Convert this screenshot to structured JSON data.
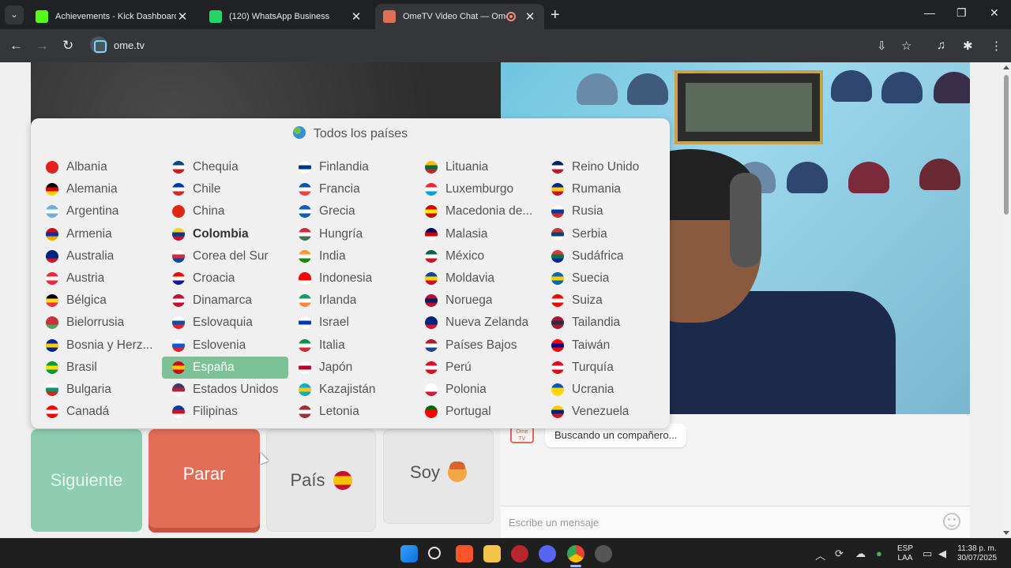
{
  "browser": {
    "tabs": [
      {
        "title": "Achievements - Kick Dashboard",
        "favicon": "kick-icon",
        "color": "#53fc18",
        "active": false
      },
      {
        "title": "(120) WhatsApp Business",
        "favicon": "whatsapp-icon",
        "color": "#25d366",
        "active": false
      },
      {
        "title": "OmeTV Video Chat — Omegle R",
        "favicon": "ometv-icon",
        "color": "#e36e58",
        "active": true
      }
    ],
    "url": "ome.tv"
  },
  "page": {
    "dropdown": {
      "header": "Todos los países",
      "columns": [
        [
          {
            "name": "Albania",
            "flag": [
              "#e41e20",
              "#e41e20",
              "#e41e20"
            ]
          },
          {
            "name": "Alemania",
            "flag": [
              "#000000",
              "#dd0000",
              "#ffce00"
            ]
          },
          {
            "name": "Argentina",
            "flag": [
              "#74acdf",
              "#ffffff",
              "#74acdf"
            ]
          },
          {
            "name": "Armenia",
            "flag": [
              "#d90012",
              "#0033a0",
              "#f2a800"
            ]
          },
          {
            "name": "Australia",
            "flag": [
              "#00247d",
              "#00247d",
              "#cf142b"
            ]
          },
          {
            "name": "Austria",
            "flag": [
              "#ed2939",
              "#ffffff",
              "#ed2939"
            ]
          },
          {
            "name": "Bélgica",
            "flag": [
              "#000000",
              "#fdda24",
              "#ef3340"
            ]
          },
          {
            "name": "Bielorrusia",
            "flag": [
              "#c8313e",
              "#c8313e",
              "#4aa657"
            ]
          },
          {
            "name": "Bosnia y Herz...",
            "flag": [
              "#002395",
              "#fecb00",
              "#002395"
            ]
          },
          {
            "name": "Brasil",
            "flag": [
              "#009c3b",
              "#ffdf00",
              "#009c3b"
            ]
          },
          {
            "name": "Bulgaria",
            "flag": [
              "#ffffff",
              "#00966e",
              "#d62612"
            ]
          },
          {
            "name": "Canadá",
            "flag": [
              "#ff0000",
              "#ffffff",
              "#ff0000"
            ]
          }
        ],
        [
          {
            "name": "Chequia",
            "flag": [
              "#11457e",
              "#ffffff",
              "#d7141a"
            ]
          },
          {
            "name": "Chile",
            "flag": [
              "#0039a6",
              "#ffffff",
              "#d52b1e"
            ]
          },
          {
            "name": "China",
            "flag": [
              "#de2910",
              "#de2910",
              "#de2910"
            ]
          },
          {
            "name": "Colombia",
            "flag": [
              "#fcd116",
              "#003893",
              "#ce1126"
            ],
            "bold": true
          },
          {
            "name": "Corea del Sur",
            "flag": [
              "#ffffff",
              "#cd2e3a",
              "#0047a0"
            ]
          },
          {
            "name": "Croacia",
            "flag": [
              "#ff0000",
              "#ffffff",
              "#171796"
            ]
          },
          {
            "name": "Dinamarca",
            "flag": [
              "#c60c30",
              "#ffffff",
              "#c60c30"
            ]
          },
          {
            "name": "Eslovaquia",
            "flag": [
              "#ffffff",
              "#0b4ea2",
              "#ee1c25"
            ]
          },
          {
            "name": "Eslovenia",
            "flag": [
              "#ffffff",
              "#005ce5",
              "#ed1c24"
            ]
          },
          {
            "name": "España",
            "flag": [
              "#c60b1e",
              "#ffc400",
              "#c60b1e"
            ],
            "selected": true
          },
          {
            "name": "Estados Unidos",
            "flag": [
              "#3c3b6e",
              "#b22234",
              "#ffffff"
            ]
          },
          {
            "name": "Filipinas",
            "flag": [
              "#0038a8",
              "#ce1126",
              "#ffffff"
            ]
          }
        ],
        [
          {
            "name": "Finlandia",
            "flag": [
              "#ffffff",
              "#003580",
              "#ffffff"
            ]
          },
          {
            "name": "Francia",
            "flag": [
              "#0055a4",
              "#ffffff",
              "#ef4135"
            ]
          },
          {
            "name": "Grecia",
            "flag": [
              "#0d5eaf",
              "#ffffff",
              "#0d5eaf"
            ]
          },
          {
            "name": "Hungría",
            "flag": [
              "#cd2a3e",
              "#ffffff",
              "#436f4d"
            ]
          },
          {
            "name": "India",
            "flag": [
              "#ff9933",
              "#ffffff",
              "#138808"
            ]
          },
          {
            "name": "Indonesia",
            "flag": [
              "#ff0000",
              "#ff0000",
              "#ffffff"
            ]
          },
          {
            "name": "Irlanda",
            "flag": [
              "#169b62",
              "#ffffff",
              "#ff883e"
            ]
          },
          {
            "name": "Israel",
            "flag": [
              "#ffffff",
              "#0038b8",
              "#ffffff"
            ]
          },
          {
            "name": "Italia",
            "flag": [
              "#009246",
              "#ffffff",
              "#ce2b37"
            ]
          },
          {
            "name": "Japón",
            "flag": [
              "#ffffff",
              "#bc002d",
              "#ffffff"
            ]
          },
          {
            "name": "Kazajistán",
            "flag": [
              "#00afca",
              "#fec50c",
              "#00afca"
            ]
          },
          {
            "name": "Letonia",
            "flag": [
              "#9e3039",
              "#ffffff",
              "#9e3039"
            ]
          }
        ],
        [
          {
            "name": "Lituania",
            "flag": [
              "#fdb913",
              "#006a44",
              "#c1272d"
            ]
          },
          {
            "name": "Luxemburgo",
            "flag": [
              "#ed2939",
              "#ffffff",
              "#00a1de"
            ]
          },
          {
            "name": "Macedonia de...",
            "flag": [
              "#d20000",
              "#ffe600",
              "#d20000"
            ]
          },
          {
            "name": "Malasia",
            "flag": [
              "#010066",
              "#cc0001",
              "#ffffff"
            ]
          },
          {
            "name": "México",
            "flag": [
              "#006847",
              "#ffffff",
              "#ce1126"
            ]
          },
          {
            "name": "Moldavia",
            "flag": [
              "#0046ae",
              "#ffd200",
              "#cc092f"
            ]
          },
          {
            "name": "Noruega",
            "flag": [
              "#ba0c2f",
              "#00205b",
              "#ba0c2f"
            ]
          },
          {
            "name": "Nueva Zelanda",
            "flag": [
              "#00247d",
              "#00247d",
              "#cc142b"
            ]
          },
          {
            "name": "Países Bajos",
            "flag": [
              "#ae1c28",
              "#ffffff",
              "#21468b"
            ]
          },
          {
            "name": "Perú",
            "flag": [
              "#d91023",
              "#ffffff",
              "#d91023"
            ]
          },
          {
            "name": "Polonia",
            "flag": [
              "#ffffff",
              "#ffffff",
              "#dc143c"
            ]
          },
          {
            "name": "Portugal",
            "flag": [
              "#006600",
              "#ff0000",
              "#ff0000"
            ]
          }
        ],
        [
          {
            "name": "Reino Unido",
            "flag": [
              "#012169",
              "#ffffff",
              "#c8102e"
            ]
          },
          {
            "name": "Rumania",
            "flag": [
              "#002b7f",
              "#fcd116",
              "#ce1126"
            ]
          },
          {
            "name": "Rusia",
            "flag": [
              "#ffffff",
              "#0039a6",
              "#d52b1e"
            ]
          },
          {
            "name": "Serbia",
            "flag": [
              "#c6363c",
              "#0c4076",
              "#ffffff"
            ]
          },
          {
            "name": "Sudáfrica",
            "flag": [
              "#de3831",
              "#007a4d",
              "#002395"
            ]
          },
          {
            "name": "Suecia",
            "flag": [
              "#006aa7",
              "#fecc00",
              "#006aa7"
            ]
          },
          {
            "name": "Suiza",
            "flag": [
              "#ff0000",
              "#ffffff",
              "#ff0000"
            ]
          },
          {
            "name": "Tailandia",
            "flag": [
              "#a51931",
              "#2d2a4a",
              "#a51931"
            ]
          },
          {
            "name": "Taiwán",
            "flag": [
              "#fe0000",
              "#000095",
              "#fe0000"
            ]
          },
          {
            "name": "Turquía",
            "flag": [
              "#e30a17",
              "#ffffff",
              "#e30a17"
            ]
          },
          {
            "name": "Ucrania",
            "flag": [
              "#0057b7",
              "#ffd700",
              "#ffd700"
            ]
          },
          {
            "name": "Venezuela",
            "flag": [
              "#ffcc00",
              "#00247d",
              "#cf142b"
            ]
          }
        ]
      ]
    },
    "buttons": {
      "next": "Siguiente",
      "stop": "Parar",
      "country": "País",
      "soy": "Soy"
    },
    "chat": {
      "logo_top": "Ome",
      "logo_bottom": "TV",
      "status_message": "Buscando un compañero...",
      "input_placeholder": "Escribe un mensaje"
    }
  },
  "taskbar": {
    "language": "ESP",
    "layout": "LAA",
    "time": "11:38 p. m.",
    "date": "30/07/2025"
  }
}
